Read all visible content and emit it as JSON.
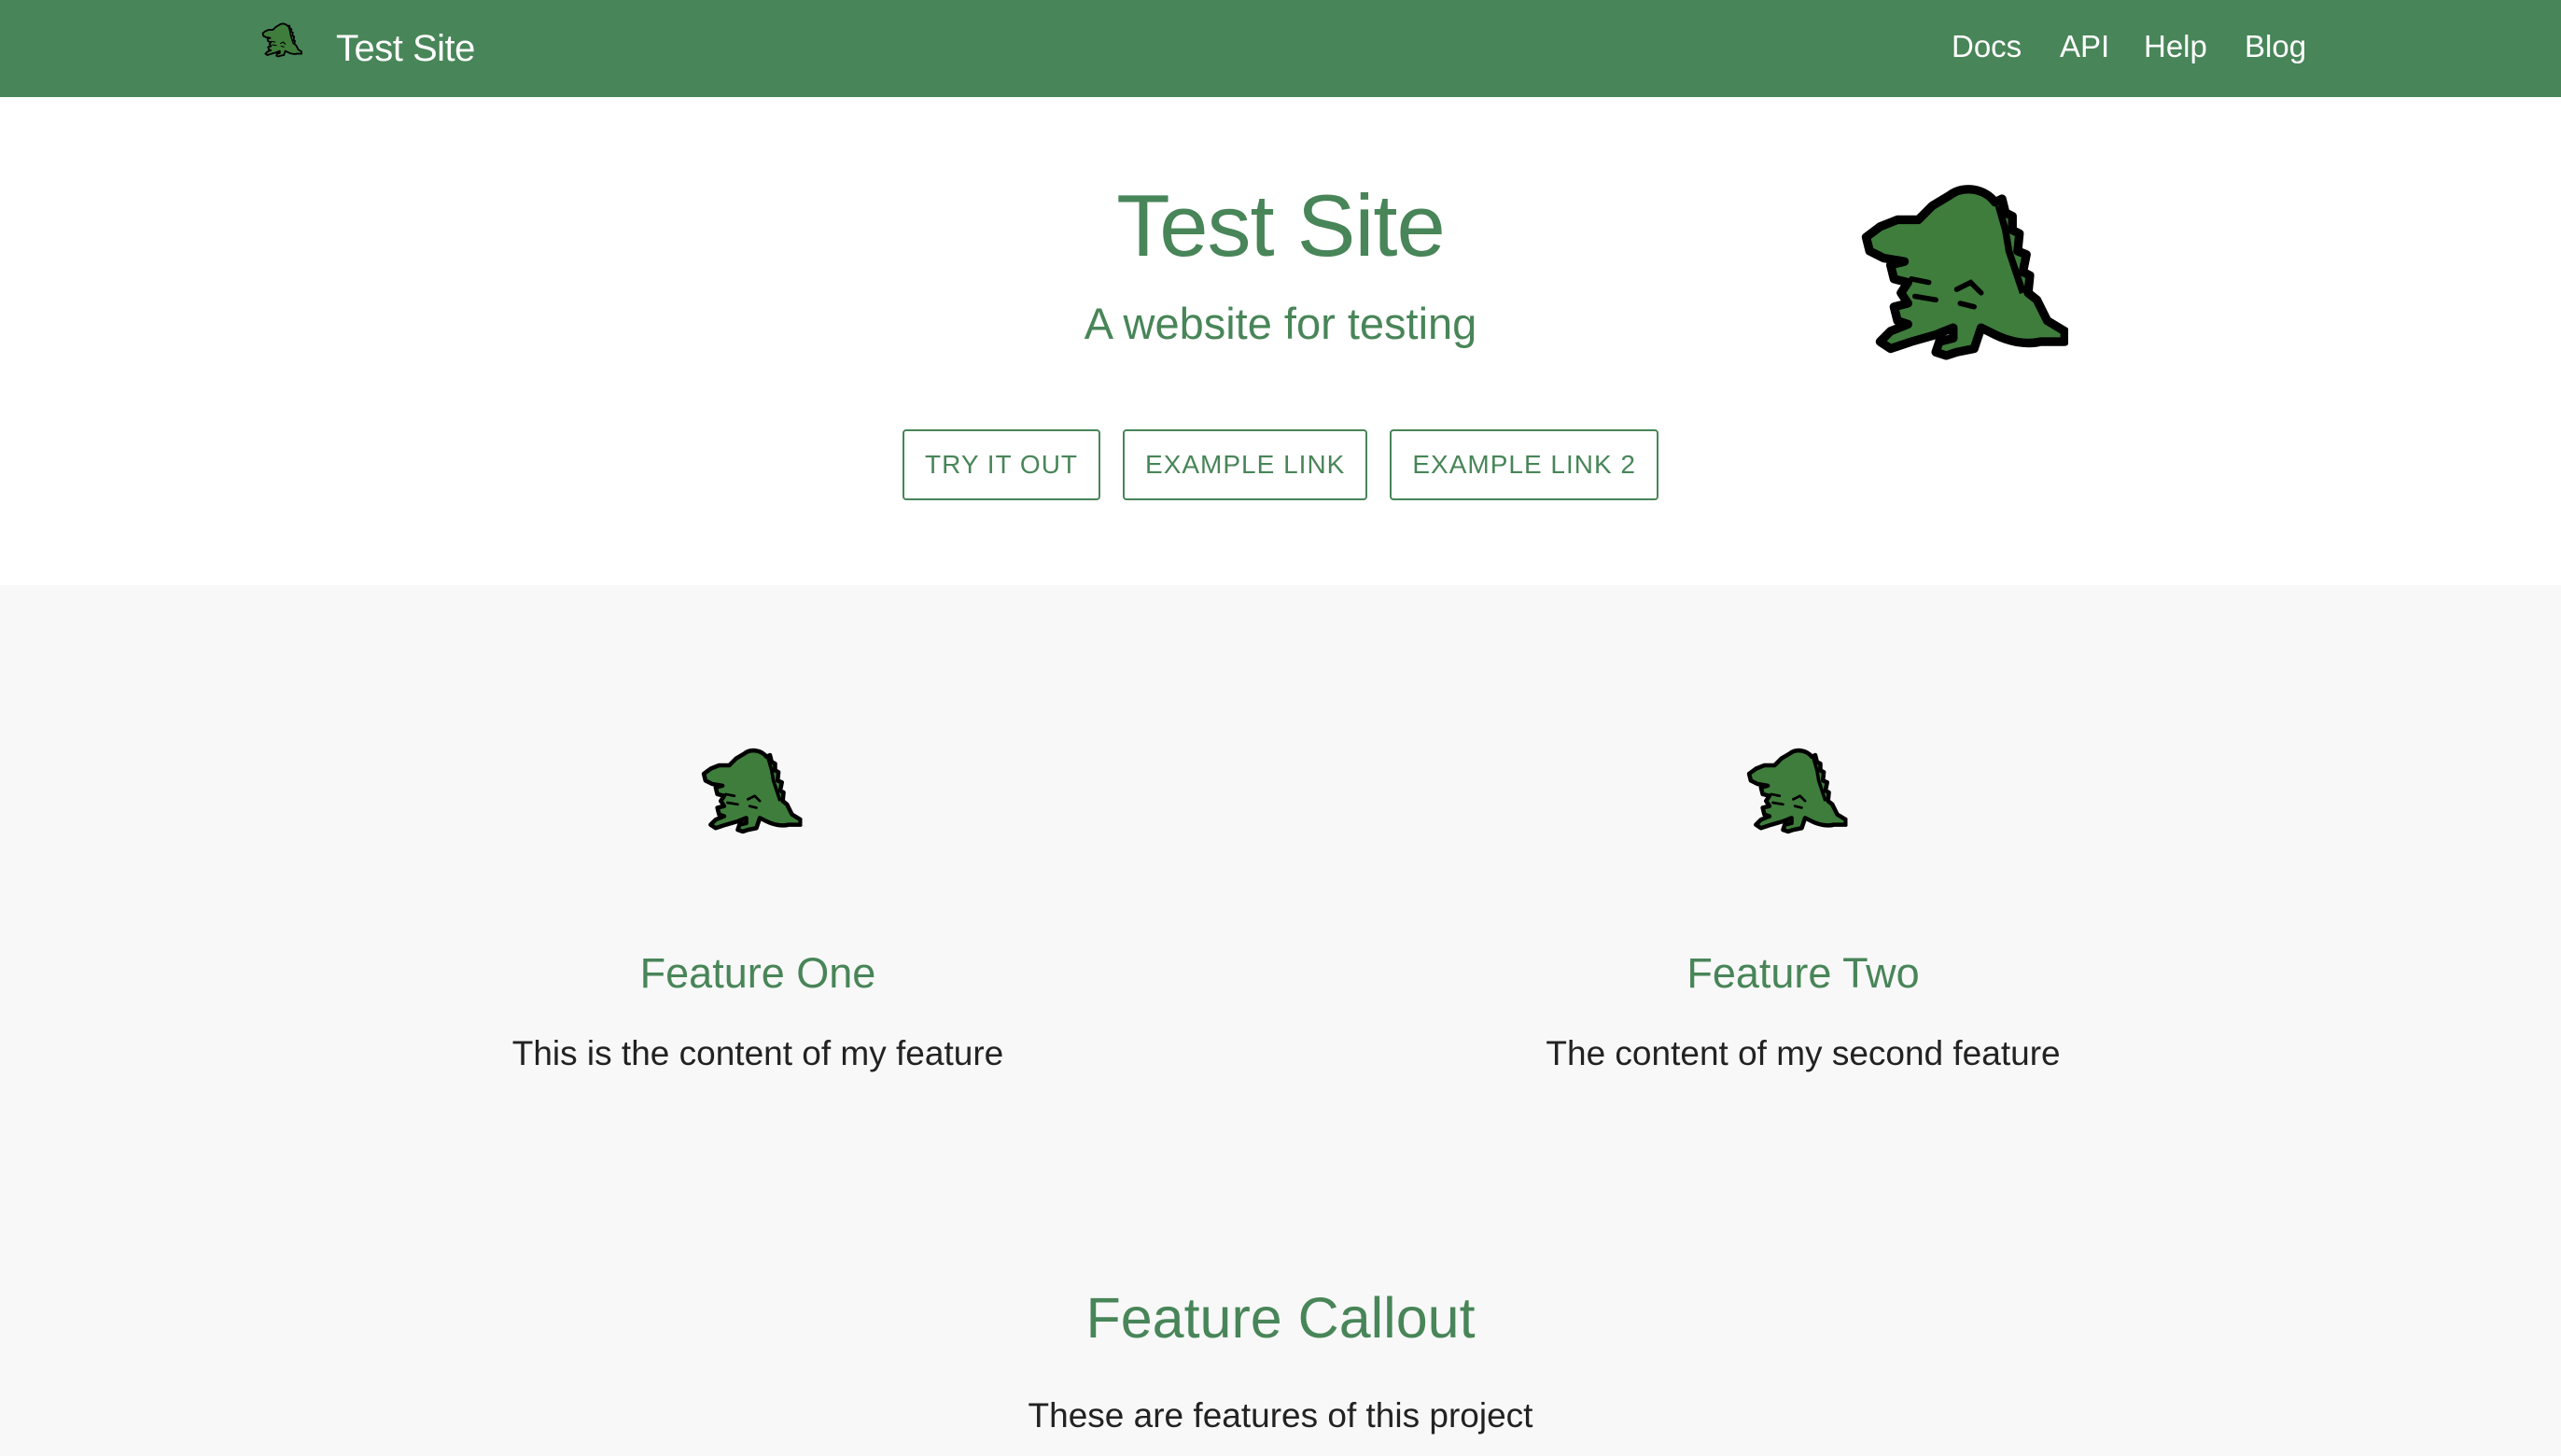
{
  "nav": {
    "logo_icon": "dinosaur-icon",
    "title": "Test Site",
    "links": [
      "Docs",
      "API",
      "Help",
      "Blog"
    ]
  },
  "hero": {
    "title": "Test Site",
    "subtitle": "A website for testing",
    "buttons": [
      "TRY IT OUT",
      "EXAMPLE LINK",
      "EXAMPLE LINK 2"
    ],
    "logo_icon": "dinosaur-icon"
  },
  "features": [
    {
      "icon": "dinosaur-icon",
      "title": "Feature One",
      "text": "This is the content of my feature"
    },
    {
      "icon": "dinosaur-icon",
      "title": "Feature Two",
      "text": "The content of my second feature"
    }
  ],
  "callout": {
    "title": "Feature Callout",
    "text": "These are features of this project"
  },
  "colors": {
    "brand_green": "#488558",
    "dino_green": "#3f7d3c",
    "section_bg": "#f8f8f8",
    "hero_bg": "#ffffff"
  }
}
